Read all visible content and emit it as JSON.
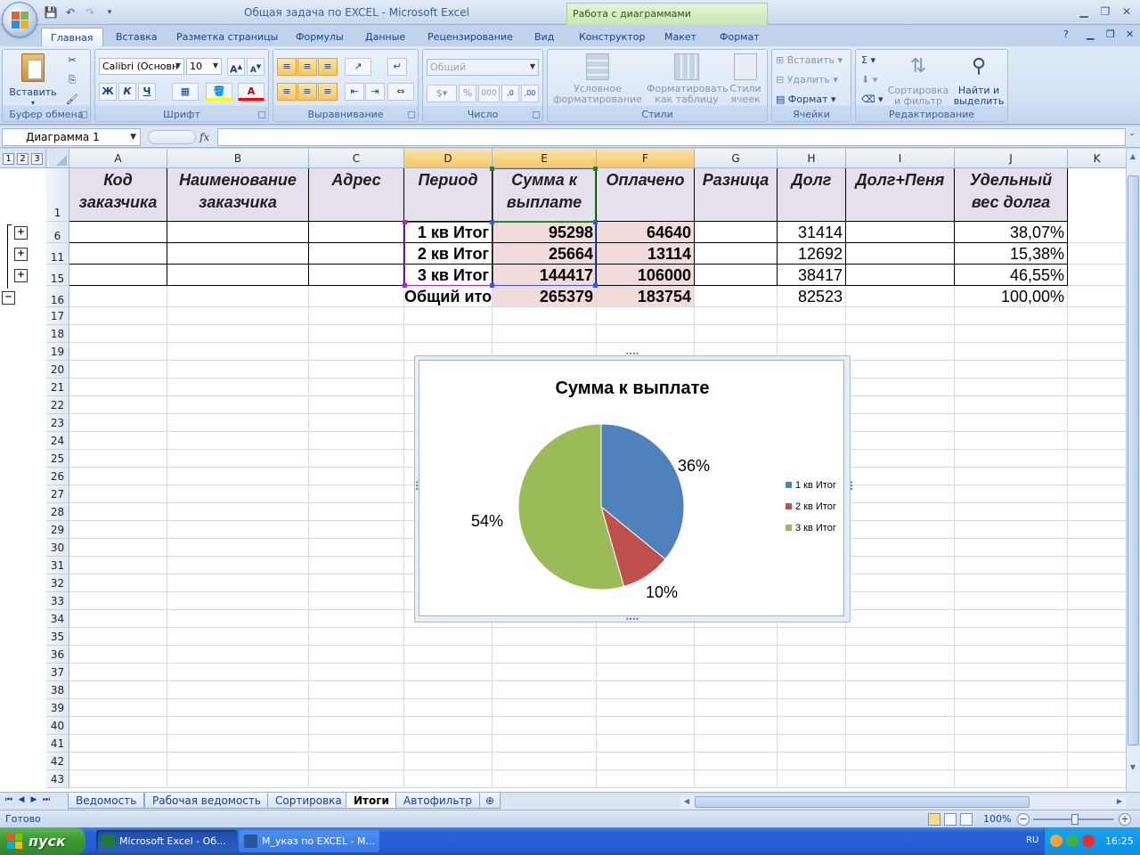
{
  "window": {
    "title": "Общая задача по EXCEL  -  Microsoft Excel",
    "context_tab_title": "Работа с диаграммами"
  },
  "ribbon_tabs": [
    "Главная",
    "Вставка",
    "Разметка страницы",
    "Формулы",
    "Данные",
    "Рецензирование",
    "Вид",
    "Конструктор",
    "Макет",
    "Формат"
  ],
  "active_tab": "Главная",
  "ribbon": {
    "clipboard": {
      "label": "Буфер обмена",
      "paste": "Вставить"
    },
    "font": {
      "label": "Шрифт",
      "font_name": "Calibri (Основн",
      "font_size": "10",
      "bold": "Ж",
      "italic": "К",
      "underline": "Ч"
    },
    "alignment": {
      "label": "Выравнивание"
    },
    "number": {
      "label": "Число",
      "format": "Общий"
    },
    "styles": {
      "label": "Стили",
      "conditional": "Условное форматирование",
      "table": "Форматировать как таблицу",
      "cell_styles": "Стили ячеек"
    },
    "cells": {
      "label": "Ячейки",
      "insert": "Вставить",
      "delete": "Удалить",
      "format": "Формат"
    },
    "editing": {
      "label": "Редактирование",
      "sort": "Сортировка и фильтр",
      "find": "Найти и выделить"
    }
  },
  "formula_bar": {
    "name_box": "Диаграмма 1",
    "fx": "fx",
    "value": ""
  },
  "outline_levels": [
    "1",
    "2",
    "3"
  ],
  "columns": [
    "A",
    "B",
    "C",
    "D",
    "E",
    "F",
    "G",
    "H",
    "I",
    "J",
    "K"
  ],
  "header_row": {
    "row_num": "1",
    "cells": [
      "Код заказчика",
      "Наименование заказчика",
      "Адрес",
      "Период",
      "Сумма к выплате",
      "Оплачено",
      "Разница",
      "Долг",
      "Долг+Пеня",
      "Удельный вес долга"
    ]
  },
  "data_rows": [
    {
      "row_num": "6",
      "period": "1 кв Итог",
      "sum": "95298",
      "paid": "64640",
      "debt": "31414",
      "share": "38,07%"
    },
    {
      "row_num": "11",
      "period": "2 кв Итог",
      "sum": "25664",
      "paid": "13114",
      "debt": "12692",
      "share": "15,38%"
    },
    {
      "row_num": "15",
      "period": "3 кв Итог",
      "sum": "144417",
      "paid": "106000",
      "debt": "38417",
      "share": "46,55%"
    },
    {
      "row_num": "16",
      "period": "Общий ито",
      "sum": "265379",
      "paid": "183754",
      "debt": "82523",
      "share": "100,00%"
    }
  ],
  "empty_rows": [
    "17",
    "18",
    "19",
    "20",
    "21",
    "22",
    "23",
    "24",
    "25",
    "26",
    "27",
    "28",
    "29",
    "30",
    "31",
    "32",
    "33",
    "34",
    "35",
    "36",
    "37",
    "38",
    "39",
    "40",
    "41",
    "42",
    "43"
  ],
  "chart_data": {
    "type": "pie",
    "title": "Сумма к выплате",
    "categories": [
      "1 кв Итог",
      "2 кв Итог",
      "3 кв Итог"
    ],
    "values": [
      95298,
      25664,
      144417
    ],
    "data_labels": [
      "36%",
      "10%",
      "54%"
    ],
    "colors": [
      "#4f81bd",
      "#c0504d",
      "#9bbb59"
    ],
    "legend": "right"
  },
  "sheet_tabs": [
    "Ведомость",
    "Рабочая ведомость",
    "Сортировка",
    "Итоги",
    "Автофильтр"
  ],
  "active_sheet": "Итоги",
  "status": {
    "text": "Готово",
    "zoom": "100%"
  },
  "taskbar": {
    "start": "пуск",
    "items": [
      "Microsoft Excel - Об...",
      "М_указ по EXCEL - M..."
    ],
    "lang": "RU",
    "time": "16:25"
  }
}
